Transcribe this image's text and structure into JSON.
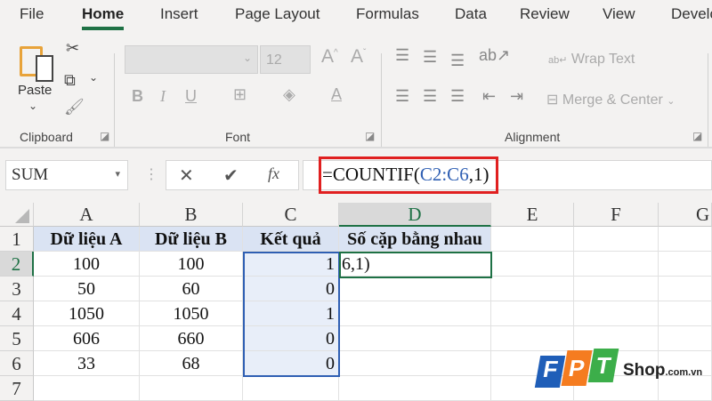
{
  "tabs": [
    "File",
    "Home",
    "Insert",
    "Page Layout",
    "Formulas",
    "Data",
    "Review",
    "View",
    "Develo"
  ],
  "active_tab": "Home",
  "ribbon": {
    "paste": "Paste",
    "font_size": "12",
    "wrap_text": "Wrap Text",
    "merge_center": "Merge & Center",
    "groups": [
      "Clipboard",
      "Font",
      "Alignment"
    ]
  },
  "name_box": "SUM",
  "formula": {
    "prefix": "=COUNTIF(",
    "range": "C2:C6",
    "suffix": ",1)"
  },
  "formula_icons": {
    "cancel": "✕",
    "enter": "✔",
    "fx": "fx"
  },
  "columns": [
    "A",
    "B",
    "C",
    "D",
    "E",
    "F",
    "G"
  ],
  "rows": [
    "1",
    "2",
    "3",
    "4",
    "5",
    "6",
    "7"
  ],
  "headers": [
    "Dữ liệu A",
    "Dữ liệu B",
    "Kết quả",
    "Số cặp bằng nhau"
  ],
  "data": [
    [
      "100",
      "100",
      "1"
    ],
    [
      "50",
      "60",
      "0"
    ],
    [
      "1050",
      "1050",
      "1"
    ],
    [
      "606",
      "660",
      "0"
    ],
    [
      "33",
      "68",
      "0"
    ]
  ],
  "editing_cell_text": "6,1)",
  "watermark": {
    "brand": "FPT",
    "suffix": "Shop",
    "domain": ".com.vn"
  },
  "colors": {
    "accent": "#1e7145",
    "highlight_box": "#e02020",
    "range_blue": "#2f5fb3"
  }
}
